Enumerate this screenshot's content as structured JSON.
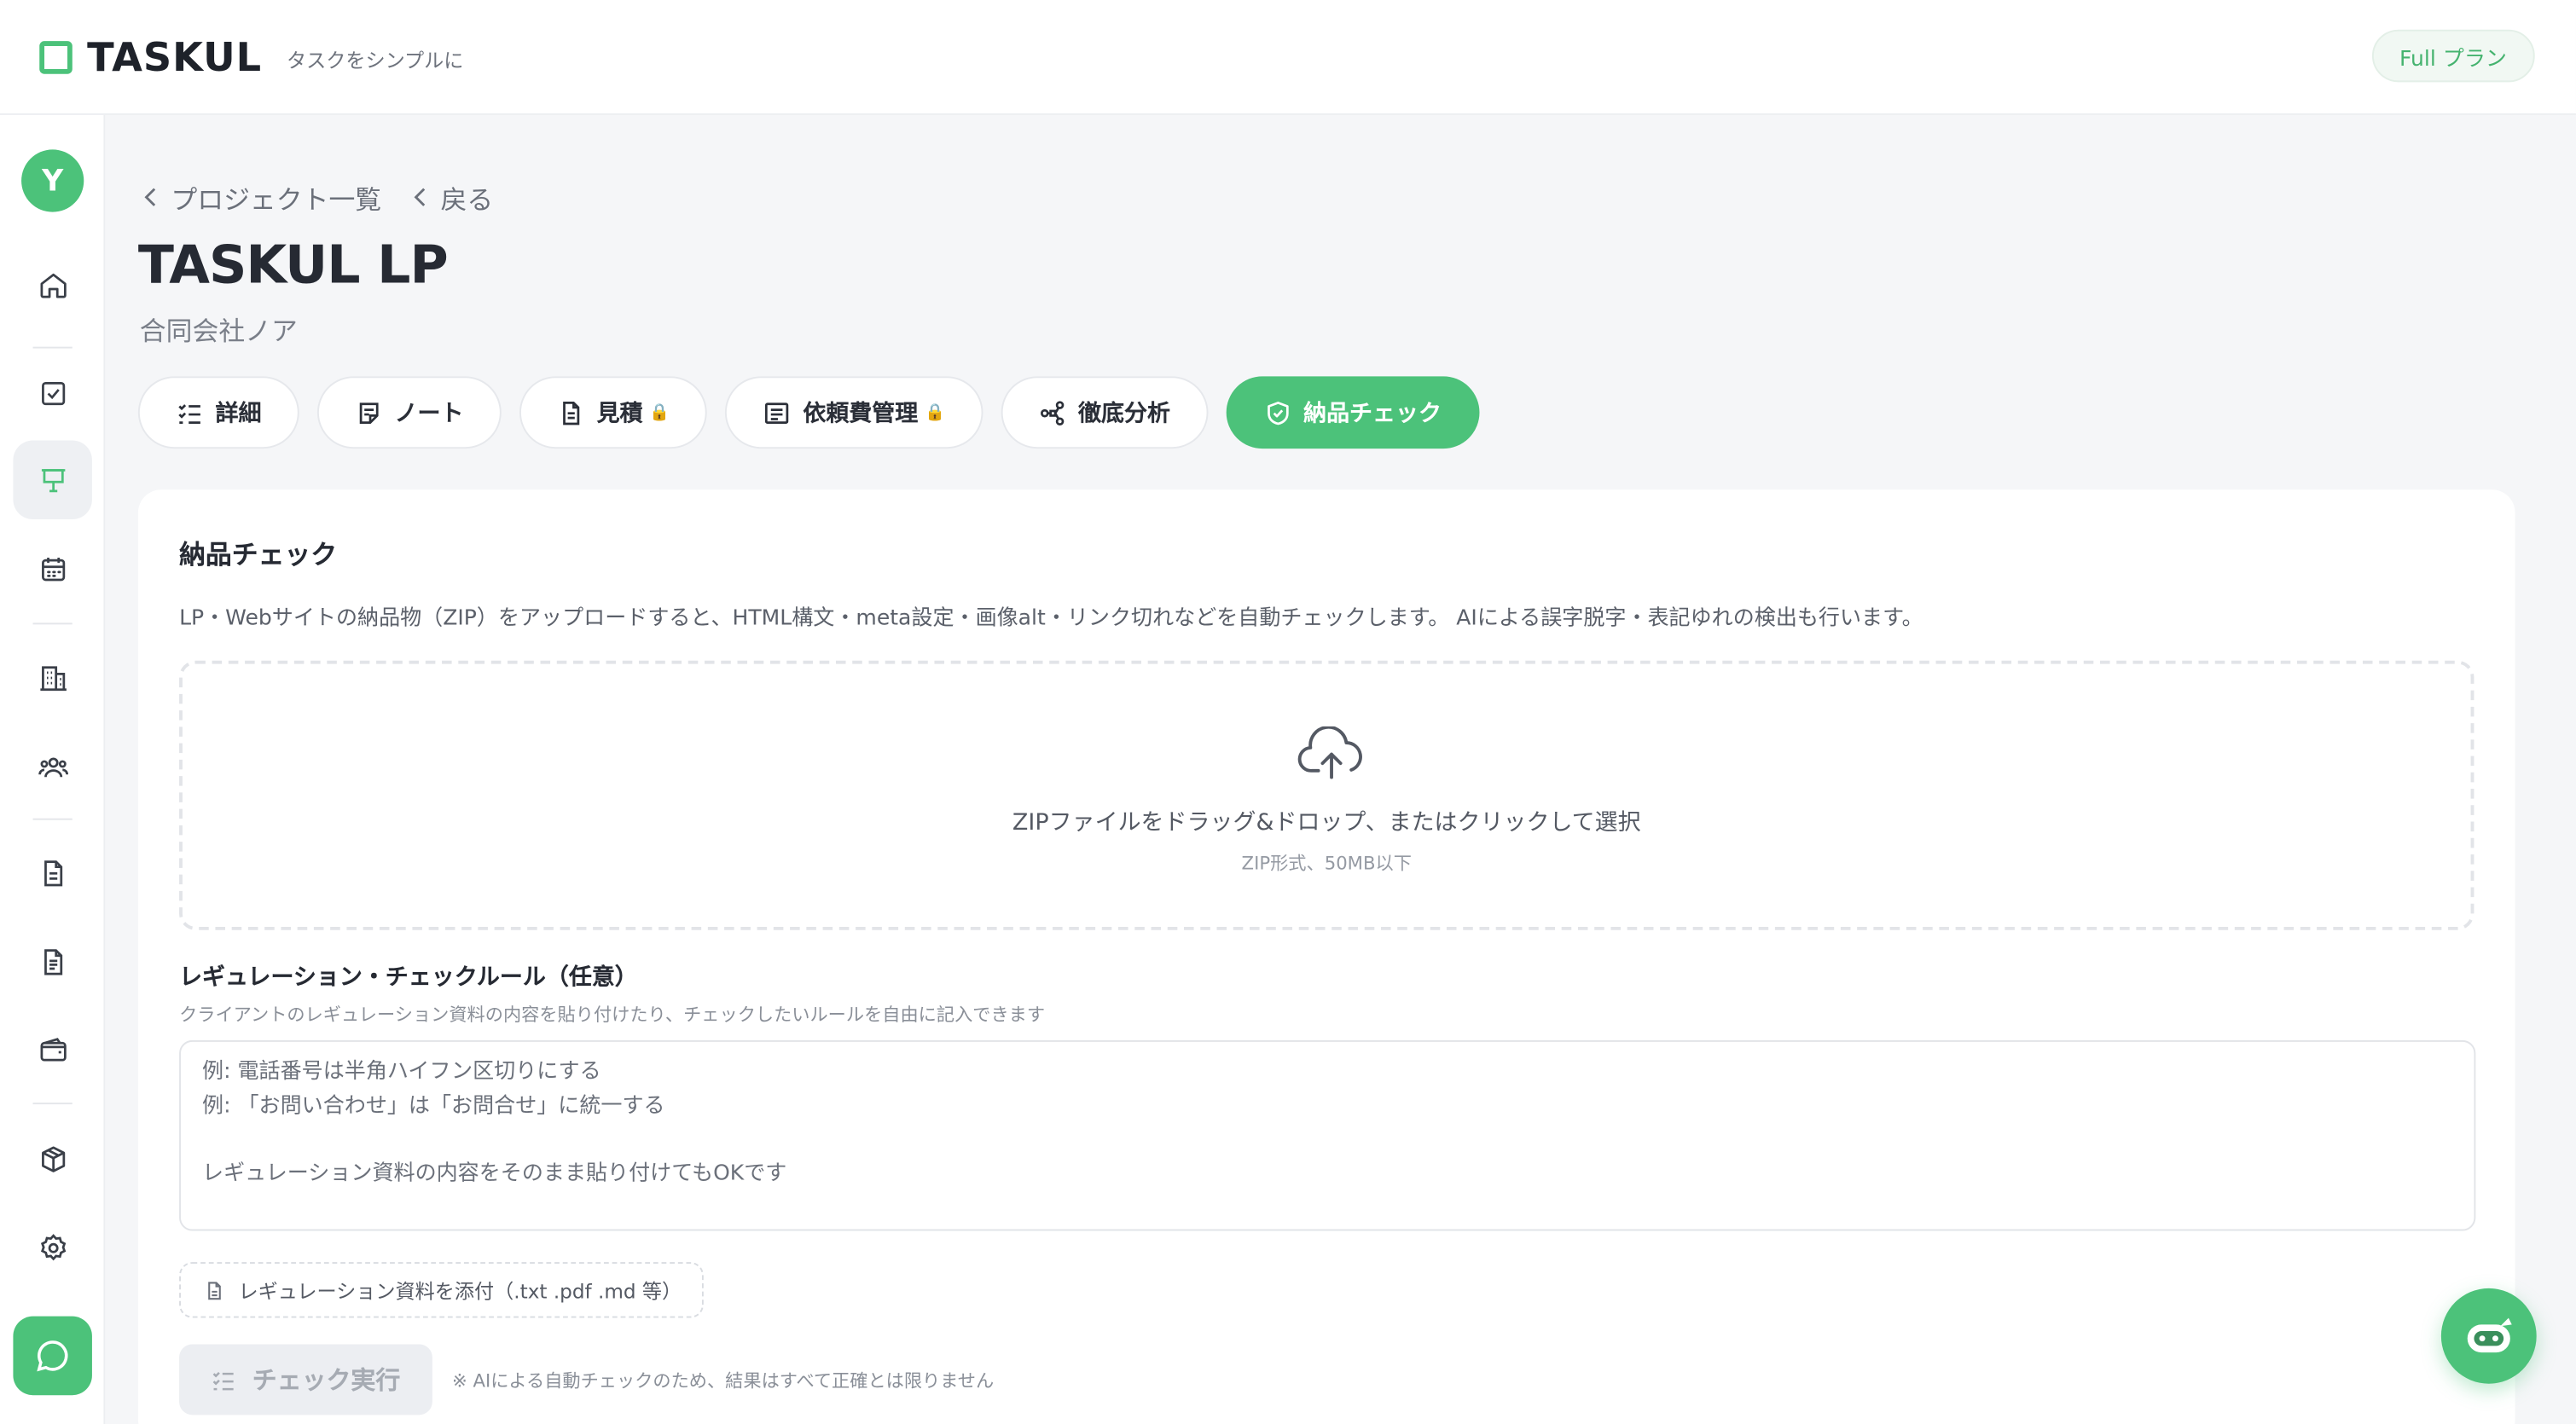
{
  "header": {
    "logo_text": "TASKUL",
    "tagline": "タスクをシンプルに",
    "plan_badge": "Full プラン"
  },
  "sidebar": {
    "avatar_initial": "Y",
    "items": [
      {
        "id": "home",
        "icon": "home-icon"
      },
      {
        "id": "tasks",
        "icon": "checkbox-icon"
      },
      {
        "id": "projects",
        "icon": "presentation-board-icon",
        "active": true
      },
      {
        "id": "calendar",
        "icon": "calendar-icon"
      },
      {
        "id": "clients",
        "icon": "building-icon"
      },
      {
        "id": "members",
        "icon": "users-icon"
      },
      {
        "id": "documents",
        "icon": "document-icon"
      },
      {
        "id": "invoices",
        "icon": "invoice-icon"
      },
      {
        "id": "wallet",
        "icon": "wallet-icon"
      },
      {
        "id": "packages",
        "icon": "package-icon"
      },
      {
        "id": "settings",
        "icon": "gear-icon"
      }
    ],
    "chat_icon": "chat-bubble-icon"
  },
  "breadcrumb": {
    "items": [
      {
        "label": "プロジェクト一覧"
      },
      {
        "label": "戻る"
      }
    ]
  },
  "page": {
    "title": "TASKUL LP",
    "subtitle": "合同会社ノア"
  },
  "tabs": [
    {
      "label": "詳細",
      "icon": "list-check-icon",
      "locked": false
    },
    {
      "label": "ノート",
      "icon": "note-icon",
      "locked": false
    },
    {
      "label": "見積",
      "icon": "document-icon",
      "locked": true
    },
    {
      "label": "依頼費管理",
      "icon": "message-square-icon",
      "locked": true
    },
    {
      "label": "徹底分析",
      "icon": "graph-nodes-icon",
      "locked": false
    },
    {
      "label": "納品チェック",
      "icon": "shield-check-icon",
      "locked": false,
      "active": true
    }
  ],
  "delivery_check": {
    "title": "納品チェック",
    "description": "LP・Webサイトの納品物（ZIP）をアップロードすると、HTML構文・meta設定・画像alt・リンク切れなどを自動チェックします。 AIによる誤字脱字・表記ゆれの検出も行います。",
    "dropzone": {
      "icon": "cloud-upload-icon",
      "text": "ZIPファイルをドラッグ&ドロップ、またはクリックして選択",
      "subtext": "ZIP形式、50MB以下"
    },
    "rules": {
      "title": "レギュレーション・チェックルール（任意）",
      "help": "クライアントのレギュレーション資料の内容を貼り付けたり、チェックしたいルールを自由に記入できます",
      "placeholder_lines": [
        "例: 電話番号は半角ハイフン区切りにする",
        "例: 「お問い合わせ」は「お問合せ」に統一する",
        "",
        "レギュレーション資料の内容をそのまま貼り付けてもOKです"
      ]
    },
    "attach_label": "レギュレーション資料を添付（.txt .pdf .md 等）",
    "run_label": "チェック実行",
    "run_note": "※ AIによる自動チェックのため、結果はすべて正確とは限りません"
  },
  "assistant_fab_icon": "robot-assistant-icon",
  "colors": {
    "accent": "#4cc27a",
    "background": "#f5f6f8",
    "text": "#2b2f38"
  }
}
